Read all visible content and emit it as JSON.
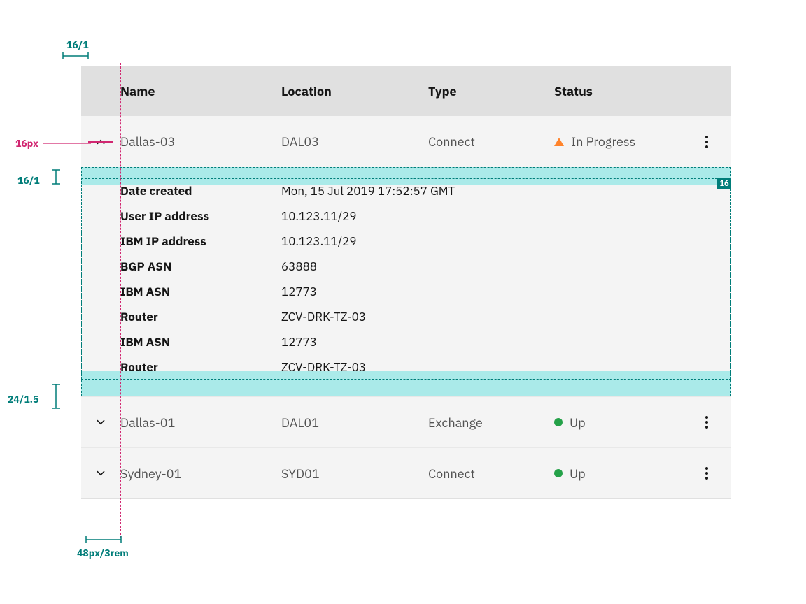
{
  "annotations": {
    "top_spacing": "16/1",
    "toggle_size": "16px",
    "panel_top_spacing": "16/1",
    "panel_bottom_spacing": "24/1.5",
    "left_indent": "48px/3rem",
    "panel_badge": "16"
  },
  "columns": {
    "name": "Name",
    "location": "Location",
    "type": "Type",
    "status": "Status"
  },
  "rows": [
    {
      "name": "Dallas-03",
      "location": "DAL03",
      "type": "Connect",
      "status": {
        "label": "In Progress",
        "kind": "warning",
        "color": "#ff832b"
      },
      "expanded": true
    },
    {
      "name": "Dallas-01",
      "location": "DAL01",
      "type": "Exchange",
      "status": {
        "label": "Up",
        "kind": "ok",
        "color": "#24a148"
      },
      "expanded": false
    },
    {
      "name": "Sydney-01",
      "location": "SYD01",
      "type": "Connect",
      "status": {
        "label": "Up",
        "kind": "ok",
        "color": "#24a148"
      },
      "expanded": false
    }
  ],
  "details": [
    {
      "key": "Date created",
      "val": "Mon, 15 Jul 2019 17:52:57 GMT"
    },
    {
      "key": "User IP address",
      "val": "10.123.11/29"
    },
    {
      "key": "IBM IP address",
      "val": "10.123.11/29"
    },
    {
      "key": "BGP ASN",
      "val": "63888"
    },
    {
      "key": "IBM ASN",
      "val": "12773"
    },
    {
      "key": "Router",
      "val": "ZCV-DRK-TZ-03"
    },
    {
      "key": "IBM ASN",
      "val": "12773"
    },
    {
      "key": "Router",
      "val": "ZCV-DRK-TZ-03"
    }
  ]
}
